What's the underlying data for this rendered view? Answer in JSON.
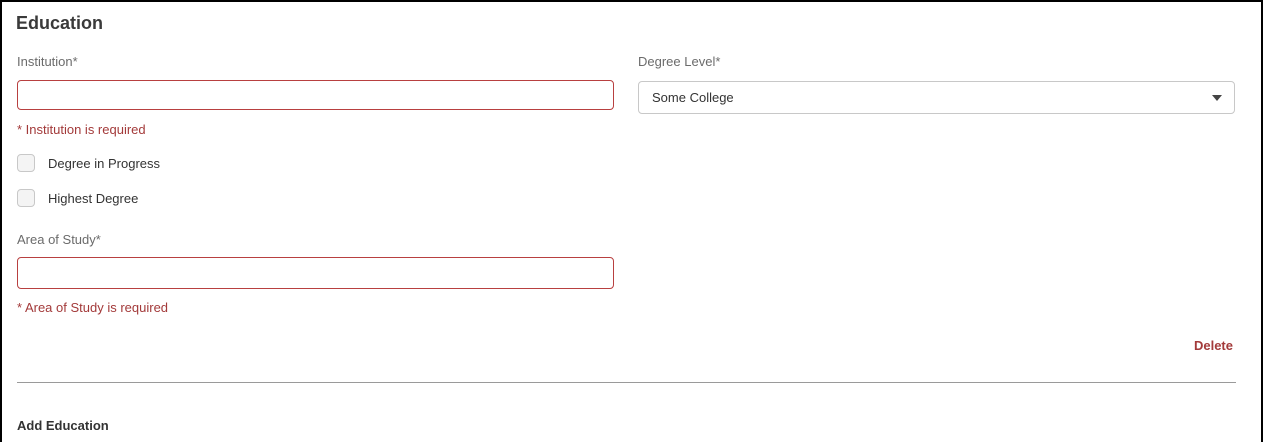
{
  "section": {
    "title": "Education"
  },
  "institution": {
    "label": "Institution*",
    "value": "",
    "error": "* Institution is required"
  },
  "degree_level": {
    "label": "Degree Level*",
    "selected": "Some College"
  },
  "checkboxes": {
    "degree_in_progress": {
      "label": "Degree in Progress",
      "checked": false
    },
    "highest_degree": {
      "label": "Highest Degree",
      "checked": false
    }
  },
  "area_of_study": {
    "label": "Area of Study*",
    "value": "",
    "error": "* Area of Study is required"
  },
  "actions": {
    "delete_label": "Delete",
    "add_label": "Add Education"
  },
  "colors": {
    "error": "#a33a3a",
    "error_border": "#b84040",
    "text": "#333333",
    "label": "#6b6b6b"
  }
}
